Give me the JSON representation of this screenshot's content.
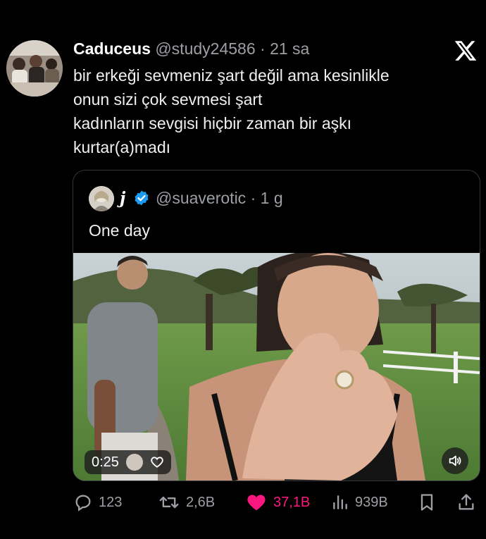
{
  "tweet": {
    "author_name": "Caduceus",
    "handle": "@study24586",
    "separator": "·",
    "time": "21 sa",
    "lines": [
      "bir erkeği sevmeniz şart değil ama kesinlikle",
      "onun sizi çok sevmesi şart",
      "kadınların sevgisi hiçbir zaman bir aşkı",
      "kurtar(a)madı"
    ],
    "avatar_icon": "group-photo-avatar",
    "brand_icon": "x-logo-icon"
  },
  "quote": {
    "author_name": "j",
    "verified_icon": "verified-badge-icon",
    "handle": "@suaverotic",
    "separator": "·",
    "time": "1 g",
    "text": "One day",
    "video": {
      "timestamp": "0:25",
      "sound_icon": "speaker-icon",
      "heart_icon": "heart-outline-icon"
    }
  },
  "actions": {
    "reply_count": "123",
    "retweet_count": "2,6B",
    "like_count": "37,1B",
    "view_count": "939B",
    "liked_color": "#f91880",
    "muted_color": "#9c9fa3"
  }
}
